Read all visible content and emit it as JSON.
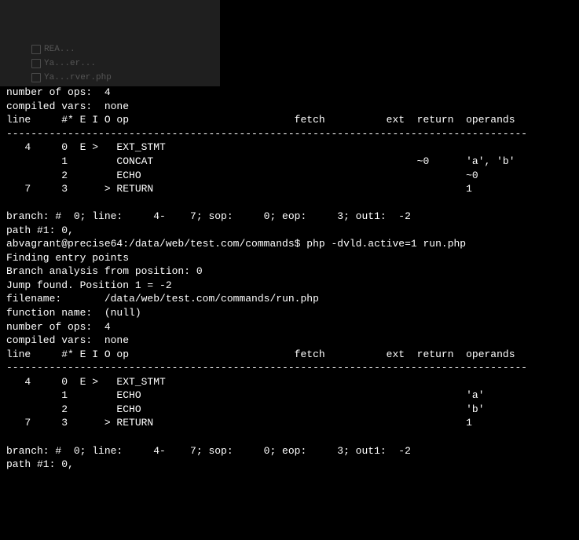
{
  "sidebar_ghost": {
    "items": [
      "REA...",
      "Ya...er...",
      "Ya...rver.php"
    ]
  },
  "block1": {
    "num_ops_label": "number of ops:",
    "num_ops_value": "4",
    "compiled_vars_label": "compiled vars:",
    "compiled_vars_value": "none",
    "header": "line     #* E I O op                           fetch          ext  return  operands",
    "divider": "-------------------------------------------------------------------------------------",
    "rows": [
      "   4     0  E >   EXT_STMT",
      "         1        CONCAT                                           ~0      'a', 'b'",
      "         2        ECHO                                                     ~0",
      "   7     3      > RETURN                                                   1",
      ""
    ],
    "branch": "branch: #  0; line:     4-    7; sop:     0; eop:     3; out1:  -2",
    "path": "path #1: 0,"
  },
  "command": "abvagrant@precise64:/data/web/test.com/commands$ php -dvld.active=1 run.php",
  "block2": {
    "finding": "Finding entry points",
    "branch_analysis": "Branch analysis from position: 0",
    "jump": "Jump found. Position 1 = -2",
    "filename_label": "filename:",
    "filename_value": "/data/web/test.com/commands/run.php",
    "funcname_label": "function name:",
    "funcname_value": "(null)",
    "num_ops_label": "number of ops:",
    "num_ops_value": "4",
    "compiled_vars_label": "compiled vars:",
    "compiled_vars_value": "none",
    "header": "line     #* E I O op                           fetch          ext  return  operands",
    "divider": "-------------------------------------------------------------------------------------",
    "rows": [
      "   4     0  E >   EXT_STMT",
      "         1        ECHO                                                     'a'",
      "         2        ECHO                                                     'b'",
      "   7     3      > RETURN                                                   1",
      ""
    ],
    "branch": "branch: #  0; line:     4-    7; sop:     0; eop:     3; out1:  -2",
    "path": "path #1: 0,"
  }
}
